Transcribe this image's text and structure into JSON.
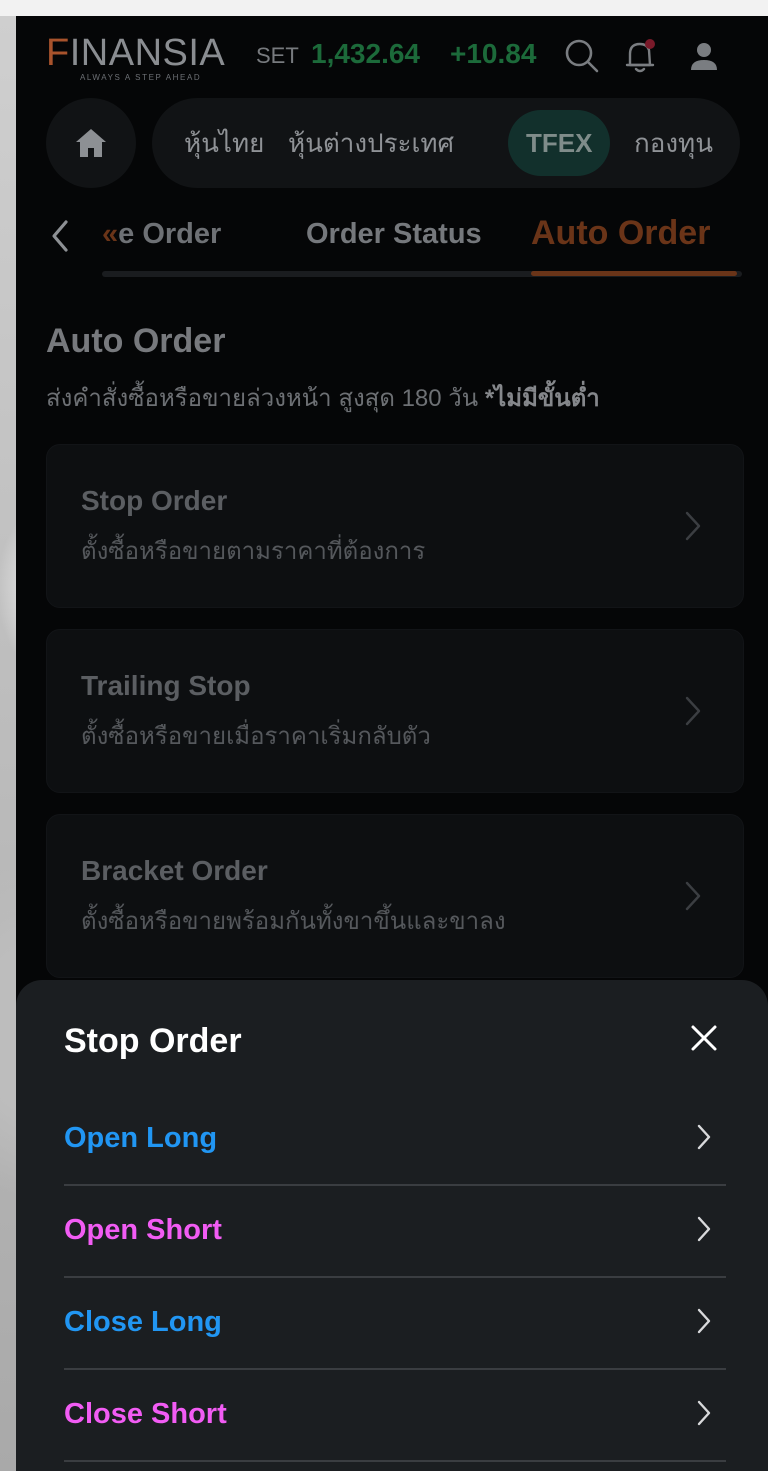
{
  "colors": {
    "screen_bg": "#050607",
    "brand_accent": "#a8532c",
    "price_up": "#1c6a3a",
    "active_tab_dim": "#6a3418",
    "sheet_bg": "#1b1e21",
    "long_blue": "#2196f3",
    "short_pink": "#f25cf4"
  },
  "header": {
    "logo_text": "INANSIA",
    "logo_letter": "F",
    "logo_tagline": "ALWAYS A STEP AHEAD",
    "index_label": "SET",
    "index_value": "1,432.64",
    "index_change": "+10.84",
    "icons": [
      "search-icon",
      "bell-icon",
      "user-icon"
    ]
  },
  "market_tabs": {
    "home_icon": "home-icon",
    "items": [
      "หุ้นไทย",
      "หุ้นต่างประเทศ",
      "TFEX",
      "กองทุน"
    ],
    "active": "TFEX"
  },
  "sub_nav": {
    "back_icon": "chevron-left-icon",
    "double_chevron": "«",
    "partial_label": "e Order",
    "items": [
      "Order Status",
      "Auto Order"
    ],
    "active": "Auto Order"
  },
  "section": {
    "title": "Auto Order",
    "description": "ส่งคำสั่งซื้อหรือขายล่วงหน้า สูงสุด 180 วัน ",
    "emphasis": "*ไม่มีขั้นต่ำ"
  },
  "cards": [
    {
      "title": "Stop Order",
      "description": "ตั้งซื้อหรือขายตามราคาที่ต้องการ"
    },
    {
      "title": "Trailing Stop",
      "description": "ตั้งซื้อหรือขายเมื่อราคาเริ่มกลับตัว"
    },
    {
      "title": "Bracket Order",
      "description": "ตั้งซื้อหรือขายพร้อมกันทั้งขาขึ้นและขาลง"
    }
  ],
  "sheet": {
    "title": "Stop Order",
    "close_icon": "close-icon",
    "options": [
      {
        "label": "Open Long",
        "side": "long"
      },
      {
        "label": "Open Short",
        "side": "short"
      },
      {
        "label": "Close Long",
        "side": "long"
      },
      {
        "label": "Close Short",
        "side": "short"
      }
    ]
  }
}
